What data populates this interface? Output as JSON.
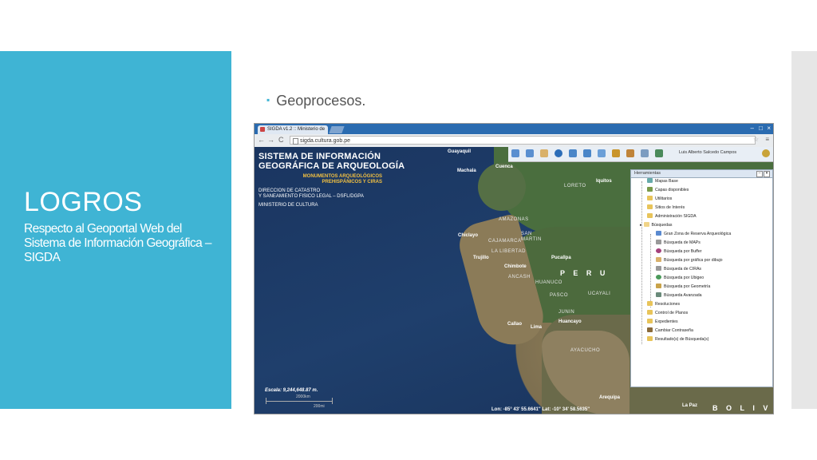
{
  "slide": {
    "title": "LOGROS",
    "subtitle": "Respecto al Geoportal Web del Sistema de Información Geográfica – SIGDA",
    "bullet": "Geoprocesos."
  },
  "browser": {
    "tab_title": "SIGDA v1.2 :: Ministerio de",
    "url": "sigda.cultura.gob.pe",
    "back": "←",
    "forward": "→",
    "reload": "C",
    "home": "⌂",
    "star": "☆",
    "menu": "≡",
    "minimize": "–",
    "maximize": "□",
    "close": "×"
  },
  "app": {
    "logo_line1": "SISTEMA DE INFORMACIÓN",
    "logo_line2": "GEOGRÁFICA DE ARQUEOLOGÍA",
    "logo_sub1": "MONUMENTOS ARQUEOLÓGICOS",
    "logo_sub2": "PREHISPÁNICOS Y CIRAS",
    "dept1": "DIRECCION DE CATASTRO",
    "dept2": "Y SANEAMIENTO FISICO LEGAL – DSFL/DGPA",
    "ministry": "MINISTERIO DE CULTURA",
    "user": "Luis Alberto Salcedo Campos",
    "scale_label": "Escala: 9,244,648.87 m.",
    "scale_top": "2000km",
    "scale_bottom": "200mi",
    "coords": "Lon: -85° 43' 55.6641\"   Lat: -10° 34' 58.5635\""
  },
  "map_labels": {
    "guayaquil": "Guayaquil",
    "cuenca": "Cuenca",
    "machala": "Machala",
    "loreto": "LORETO",
    "iquitos": "Iquitos",
    "amazonas": "AMAZONAS",
    "cajamarca": "CAJAMARCA",
    "san_martin": "SAN\nMARTIN",
    "chiclayo": "Chiclayo",
    "lalibertad": "LA LIBERTAD",
    "trujillo": "Trujillo",
    "chimbote": "Chimbote",
    "pucallpa": "Pucallpa",
    "ancash": "ANCASH",
    "huanuco": "HUANUCO",
    "peru": "P E R U",
    "ucayali": "UCAYALI",
    "pasco": "PASCO",
    "junin": "JUNIN",
    "callao": "Callao",
    "lima": "Lima",
    "huancayo": "Huancayo",
    "ayacucho": "AYACUCHO",
    "arequipa": "Arequipa",
    "lapaz": "La Paz",
    "bolivia": "B O L I V I A"
  },
  "panel": {
    "title": "Herramientas",
    "items": [
      "Mapas Base",
      "Capas disponibles",
      "Utilitarios",
      "Sitios de Interés",
      "Administración SIGDA",
      "Búsquedas",
      "Gran Zona de Reserva Arqueológica",
      "Búsqueda de MAPs",
      "Búsqueda por Buffer",
      "Búsqueda por gráfica por dibujo",
      "Búsqueda de CIRAs",
      "Búsqueda por Ubigeo",
      "Búsqueda por Geometría",
      "Búsqueda Avanzada",
      "Resoluciones",
      "Control de Planos",
      "Expedientes",
      "Cambiar Contraseña",
      "Resultado(s) de Búsqueda(s)"
    ]
  },
  "colors": {
    "accent": "#3fb4d4",
    "ocean": "#1d3b63",
    "land": "#4a6e3e"
  }
}
